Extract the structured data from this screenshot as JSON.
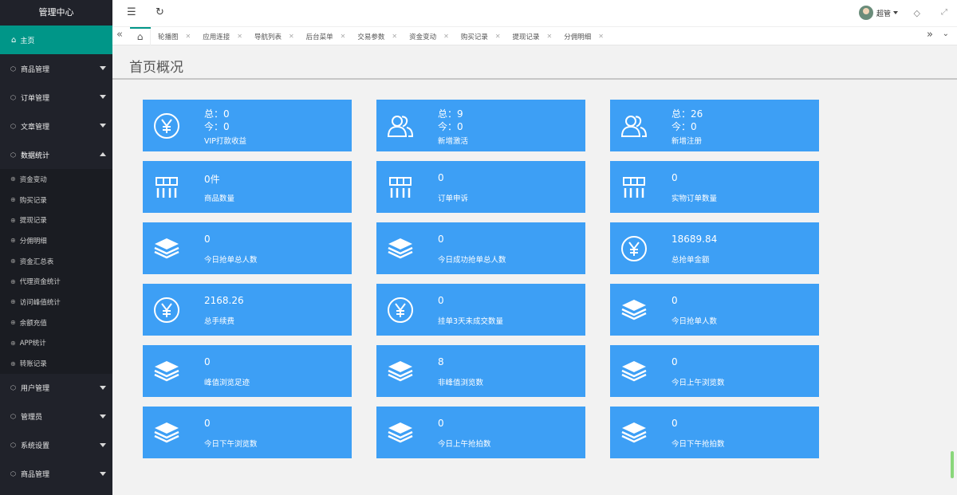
{
  "sidebar": {
    "logo": "管理中心",
    "home": "主页",
    "groups_before": [
      "商品管理",
      "订单管理",
      "文章管理"
    ],
    "open_group": "数据统计",
    "sub_items": [
      "资金变动",
      "购买记录",
      "提现记录",
      "分佣明细",
      "资金汇总表",
      "代理资金统计",
      "访问峰值统计",
      "余额充值",
      "APP统计",
      "转账记录"
    ],
    "groups_after": [
      "用户管理",
      "管理员",
      "系统设置",
      "商品管理"
    ]
  },
  "header": {
    "user_name": "超管"
  },
  "tabs": [
    "轮播图",
    "应用连接",
    "导航列表",
    "后台菜单",
    "交易参数",
    "资金变动",
    "购买记录",
    "提现记录",
    "分佣明细"
  ],
  "page_title": "首页概况",
  "cards": [
    {
      "icon": "yen",
      "line1": "总：0",
      "line2": "今：0",
      "label": "VIP打款收益"
    },
    {
      "icon": "users",
      "line1": "总：9",
      "line2": "今：0",
      "label": "新增激活"
    },
    {
      "icon": "users",
      "line1": "总：26",
      "line2": "今：0",
      "label": "新增注册"
    },
    {
      "icon": "grid",
      "value": "0件",
      "label": "商品数量"
    },
    {
      "icon": "grid",
      "value": "0",
      "label": "订单申诉"
    },
    {
      "icon": "grid",
      "value": "0",
      "label": "实物订单数量"
    },
    {
      "icon": "layers",
      "value": "0",
      "label": "今日抢单总人数"
    },
    {
      "icon": "layers",
      "value": "0",
      "label": "今日成功抢单总人数"
    },
    {
      "icon": "yen",
      "value": "18689.84",
      "label": "总抢单金额"
    },
    {
      "icon": "yen",
      "value": "2168.26",
      "label": "总手续费"
    },
    {
      "icon": "yen",
      "value": "0",
      "label": "挂单3天未成交数量"
    },
    {
      "icon": "layers",
      "value": "0",
      "label": "今日抢单人数"
    },
    {
      "icon": "layers",
      "value": "0",
      "label": "峰值浏览足迹"
    },
    {
      "icon": "layers",
      "value": "8",
      "label": "非峰值浏览数"
    },
    {
      "icon": "layers",
      "value": "0",
      "label": "今日上午浏览数"
    },
    {
      "icon": "layers",
      "value": "0",
      "label": "今日下午浏览数"
    },
    {
      "icon": "layers",
      "value": "0",
      "label": "今日上午抢拍数"
    },
    {
      "icon": "layers",
      "value": "0",
      "label": "今日下午抢拍数"
    }
  ],
  "colors": {
    "sidebar_bg": "#20222a",
    "accent": "#009688",
    "card_bg": "#3d9ff5"
  }
}
